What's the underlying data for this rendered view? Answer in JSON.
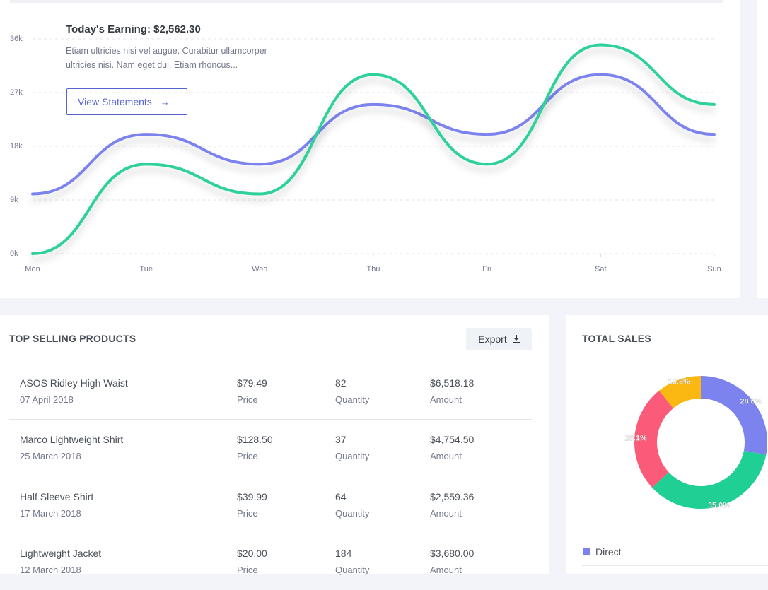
{
  "earning": {
    "title": "Today's Earning: $2,562.30",
    "description": "Etiam ultricies nisi vel augue. Curabitur ullamcorper ultricies nisi. Nam eget dui. Etiam rhoncus...",
    "button_label": "View Statements",
    "button_icon": "arrow-right-icon"
  },
  "chart_data": {
    "type": "line",
    "categories": [
      "Mon",
      "Tue",
      "Wed",
      "Thu",
      "Fri",
      "Sat",
      "Sun"
    ],
    "series": [
      {
        "values": [
          10000,
          20000,
          15000,
          25000,
          20000,
          30000,
          20000
        ],
        "color": "#7c83ee"
      },
      {
        "values": [
          0,
          15000,
          10000,
          30000,
          15000,
          35000,
          25000
        ],
        "color": "#2dd19b"
      }
    ],
    "y_ticks": [
      "0k",
      "9k",
      "18k",
      "27k",
      "36k"
    ],
    "y_tick_values": [
      0,
      9000,
      18000,
      27000,
      36000
    ],
    "ylim": [
      0,
      36000
    ],
    "grid": "dashed-horizontal",
    "curve": "smooth"
  },
  "products": {
    "title": "TOP SELLING PRODUCTS",
    "export_label": "Export",
    "export_icon": "download-icon",
    "rows": [
      {
        "name": "ASOS Ridley High Waist",
        "date": "07 April 2018",
        "price": "$79.49",
        "price_label": "Price",
        "quantity": "82",
        "quantity_label": "Quantity",
        "amount": "$6,518.18",
        "amount_label": "Amount"
      },
      {
        "name": "Marco Lightweight Shirt",
        "date": "25 March 2018",
        "price": "$128.50",
        "price_label": "Price",
        "quantity": "37",
        "quantity_label": "Quantity",
        "amount": "$4,754.50",
        "amount_label": "Amount"
      },
      {
        "name": "Half Sleeve Shirt",
        "date": "17 March 2018",
        "price": "$39.99",
        "price_label": "Price",
        "quantity": "64",
        "quantity_label": "Quantity",
        "amount": "$2,559.36",
        "amount_label": "Amount"
      },
      {
        "name": "Lightweight Jacket",
        "date": "12 March 2018",
        "price": "$20.00",
        "price_label": "Price",
        "quantity": "184",
        "quantity_label": "Quantity",
        "amount": "$3,680.00",
        "amount_label": "Amount"
      }
    ]
  },
  "sales": {
    "title": "TOTAL SALES",
    "donut": [
      {
        "label": "28.0%",
        "value": 28.0,
        "color": "#7c83ee"
      },
      {
        "label": "35.0%",
        "value": 35.0,
        "color": "#1fcf93"
      },
      {
        "label": "26.1%",
        "value": 26.1,
        "color": "#fb5a78"
      },
      {
        "label": "10.8%",
        "value": 10.8,
        "color": "#fcb812"
      }
    ],
    "legend": [
      {
        "label": "Direct",
        "color": "#7c83ee"
      }
    ]
  }
}
